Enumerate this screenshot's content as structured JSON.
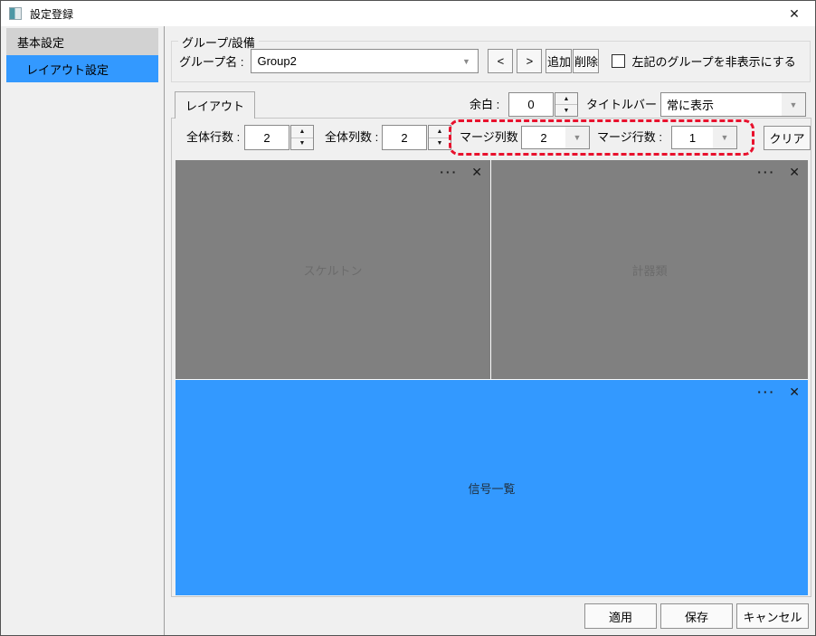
{
  "window": {
    "title": "設定登録",
    "close_glyph": "✕"
  },
  "sidebar": {
    "items": [
      {
        "label": "基本設定"
      },
      {
        "label": "レイアウト設定"
      }
    ]
  },
  "group_box": {
    "title": "グループ/設備",
    "group_name_label": "グループ名 :",
    "group_name_value": "Group2",
    "prev_label": "<",
    "next_label": ">",
    "add_label": "追加",
    "delete_label": "削除",
    "hide_checkbox_label": "左記のグループを非表示にする"
  },
  "layout_tab": {
    "label": "レイアウト"
  },
  "toolbar": {
    "margin_label": "余白 :",
    "margin_value": "0",
    "titlebar_label": "タイトルバー :",
    "titlebar_value": "常に表示",
    "rows_label": "全体行数 :",
    "rows_value": "2",
    "cols_label": "全体列数 :",
    "cols_value": "2",
    "merge_cols_label": "マージ列数 :",
    "merge_cols_value": "2",
    "merge_rows_label": "マージ行数 :",
    "merge_rows_value": "1",
    "clear_label": "クリア"
  },
  "panels": [
    {
      "label": "スケルトン",
      "color": "#808080"
    },
    {
      "label": "計器類",
      "color": "#808080"
    },
    {
      "label": "信号一覧",
      "color": "#3399ff"
    }
  ],
  "panel_controls": {
    "menu_glyph": "···",
    "close_glyph": "✕"
  },
  "icons": {
    "combo_arrow": "▼",
    "spin_up": "▲",
    "spin_down": "▼"
  },
  "footer": {
    "apply_label": "適用",
    "save_label": "保存",
    "cancel_label": "キャンセル"
  },
  "colors": {
    "selection_blue": "#3399ff",
    "panel_gray": "#808080",
    "highlight_red": "#e8112d"
  }
}
